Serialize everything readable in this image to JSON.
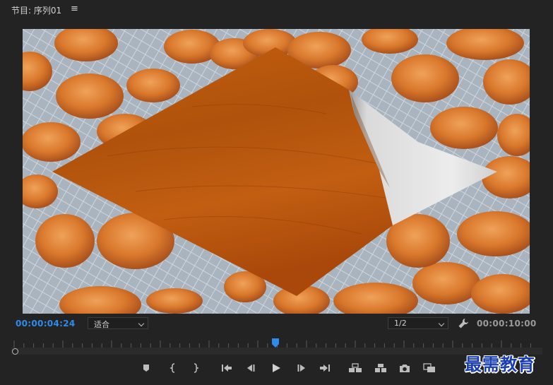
{
  "panel": {
    "title": "节目: 序列01",
    "menu_icon": "hamburger-menu-icon"
  },
  "viewer": {
    "content": "video-frame",
    "colors": {
      "background": "#a9b3bd",
      "wood": "#b5560f",
      "page_curl": "#e4e4e4",
      "apricot": "#d9782c"
    }
  },
  "controls": {
    "current_timecode": "00:00:04:24",
    "zoom": "适合",
    "resolution": "1/2",
    "duration_timecode": "00:00:10:00",
    "accent_color": "#2d8ceb"
  },
  "playback_progress": 0.4979,
  "transport_icons": [
    "marker-icon",
    "in-point-icon",
    "out-point-icon",
    "go-to-in-icon",
    "step-back-icon",
    "play-icon",
    "step-forward-icon",
    "go-to-out-icon",
    "lift-icon",
    "extract-icon",
    "export-frame-icon",
    "comparison-view-icon"
  ],
  "watermark": "最需教育"
}
